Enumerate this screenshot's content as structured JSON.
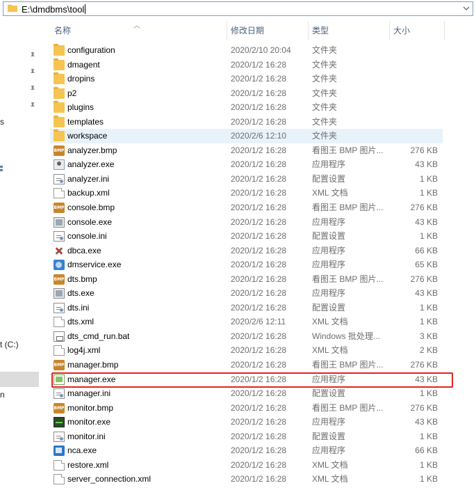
{
  "address_bar": {
    "path": "E:\\dmdbms\\tool"
  },
  "nav": {
    "fragments": [
      "s",
      "",
      "t (C:)",
      "n"
    ]
  },
  "columns": {
    "name": "名称",
    "date": "修改日期",
    "type": "类型",
    "size": "大小"
  },
  "files": [
    {
      "name": "configuration",
      "date": "2020/2/10 20:04",
      "type": "文件夹",
      "size": "",
      "icon": "folder-icon"
    },
    {
      "name": "dmagent",
      "date": "2020/1/2 16:28",
      "type": "文件夹",
      "size": "",
      "icon": "folder-icon"
    },
    {
      "name": "dropins",
      "date": "2020/1/2 16:28",
      "type": "文件夹",
      "size": "",
      "icon": "folder-icon"
    },
    {
      "name": "p2",
      "date": "2020/1/2 16:28",
      "type": "文件夹",
      "size": "",
      "icon": "folder-icon"
    },
    {
      "name": "plugins",
      "date": "2020/1/2 16:28",
      "type": "文件夹",
      "size": "",
      "icon": "folder-icon"
    },
    {
      "name": "templates",
      "date": "2020/1/2 16:28",
      "type": "文件夹",
      "size": "",
      "icon": "folder-icon"
    },
    {
      "name": "workspace",
      "date": "2020/2/6 12:10",
      "type": "文件夹",
      "size": "",
      "icon": "folder-icon"
    },
    {
      "name": "analyzer.bmp",
      "date": "2020/1/2 16:28",
      "type": "看图王 BMP 图片...",
      "size": "276 KB",
      "icon": "bmp-icon"
    },
    {
      "name": "analyzer.exe",
      "date": "2020/1/2 16:28",
      "type": "应用程序",
      "size": "43 KB",
      "icon": "user-app-icon"
    },
    {
      "name": "analyzer.ini",
      "date": "2020/1/2 16:28",
      "type": "配置设置",
      "size": "1 KB",
      "icon": "ini-icon"
    },
    {
      "name": "backup.xml",
      "date": "2020/1/2 16:28",
      "type": "XML 文档",
      "size": "1 KB",
      "icon": "file-icon"
    },
    {
      "name": "console.bmp",
      "date": "2020/1/2 16:28",
      "type": "看图王 BMP 图片...",
      "size": "276 KB",
      "icon": "bmp-icon"
    },
    {
      "name": "console.exe",
      "date": "2020/1/2 16:28",
      "type": "应用程序",
      "size": "43 KB",
      "icon": "app-icon"
    },
    {
      "name": "console.ini",
      "date": "2020/1/2 16:28",
      "type": "配置设置",
      "size": "1 KB",
      "icon": "ini-icon"
    },
    {
      "name": "dbca.exe",
      "date": "2020/1/2 16:28",
      "type": "应用程序",
      "size": "66 KB",
      "icon": "tools-icon"
    },
    {
      "name": "dmservice.exe",
      "date": "2020/1/2 16:28",
      "type": "应用程序",
      "size": "65 KB",
      "icon": "service-icon"
    },
    {
      "name": "dts.bmp",
      "date": "2020/1/2 16:28",
      "type": "看图王 BMP 图片...",
      "size": "276 KB",
      "icon": "bmp-icon"
    },
    {
      "name": "dts.exe",
      "date": "2020/1/2 16:28",
      "type": "应用程序",
      "size": "43 KB",
      "icon": "app-icon"
    },
    {
      "name": "dts.ini",
      "date": "2020/1/2 16:28",
      "type": "配置设置",
      "size": "1 KB",
      "icon": "ini-icon"
    },
    {
      "name": "dts.xml",
      "date": "2020/2/6 12:11",
      "type": "XML 文档",
      "size": "1 KB",
      "icon": "file-icon"
    },
    {
      "name": "dts_cmd_run.bat",
      "date": "2020/1/2 16:28",
      "type": "Windows 批处理...",
      "size": "3 KB",
      "icon": "bat-icon"
    },
    {
      "name": "log4j.xml",
      "date": "2020/1/2 16:28",
      "type": "XML 文档",
      "size": "2 KB",
      "icon": "file-icon"
    },
    {
      "name": "manager.bmp",
      "date": "2020/1/2 16:28",
      "type": "看图王 BMP 图片...",
      "size": "276 KB",
      "icon": "bmp-icon"
    },
    {
      "name": "manager.exe",
      "date": "2020/1/2 16:28",
      "type": "应用程序",
      "size": "43 KB",
      "icon": "manager-icon"
    },
    {
      "name": "manager.ini",
      "date": "2020/1/2 16:28",
      "type": "配置设置",
      "size": "1 KB",
      "icon": "ini-icon"
    },
    {
      "name": "monitor.bmp",
      "date": "2020/1/2 16:28",
      "type": "看图王 BMP 图片...",
      "size": "276 KB",
      "icon": "bmp-icon"
    },
    {
      "name": "monitor.exe",
      "date": "2020/1/2 16:28",
      "type": "应用程序",
      "size": "43 KB",
      "icon": "monitor-icon"
    },
    {
      "name": "monitor.ini",
      "date": "2020/1/2 16:28",
      "type": "配置设置",
      "size": "1 KB",
      "icon": "ini-icon"
    },
    {
      "name": "nca.exe",
      "date": "2020/1/2 16:28",
      "type": "应用程序",
      "size": "66 KB",
      "icon": "nca-icon"
    },
    {
      "name": "restore.xml",
      "date": "2020/1/2 16:28",
      "type": "XML 文档",
      "size": "1 KB",
      "icon": "file-icon"
    },
    {
      "name": "server_connection.xml",
      "date": "2020/1/2 16:28",
      "type": "XML 文档",
      "size": "1 KB",
      "icon": "file-icon"
    }
  ],
  "selected_row": "workspace",
  "highlighted_row": "manager.exe",
  "bmp_icon_text": "BMP",
  "colors": {
    "highlight_border": "#e0241f",
    "selected_bg": "#e8f2fb",
    "header_text": "#4c607a"
  }
}
